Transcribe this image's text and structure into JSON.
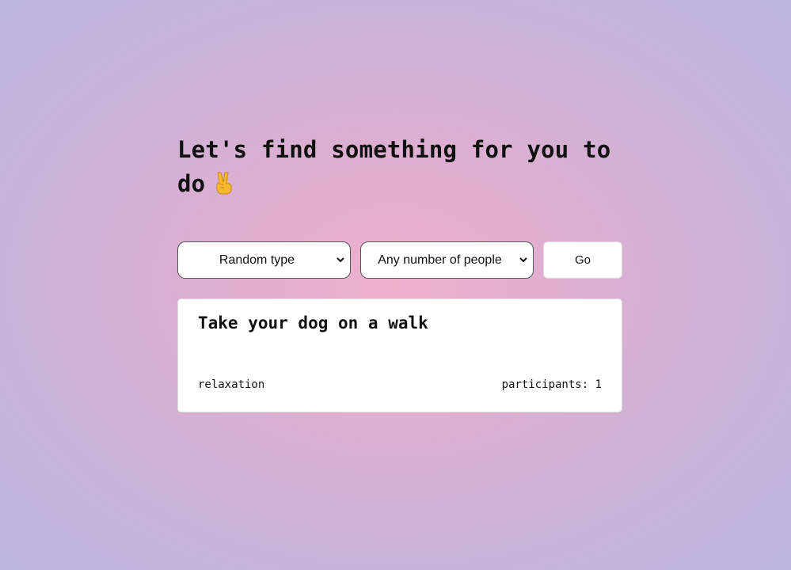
{
  "heading": {
    "text": "Let's find something for you to do",
    "emoji_icon": "victory-hand-icon"
  },
  "controls": {
    "type_select": {
      "selected": "Random type"
    },
    "participants_select": {
      "selected": "Any number of people"
    },
    "go_label": "Go"
  },
  "activity": {
    "title": "Take your dog on a walk",
    "type": "relaxation",
    "participants_label": "participants: 1"
  },
  "colors": {
    "background_center": "#efb0cc",
    "background_edge": "#bcb6dd",
    "emoji": "#f5b82e"
  }
}
